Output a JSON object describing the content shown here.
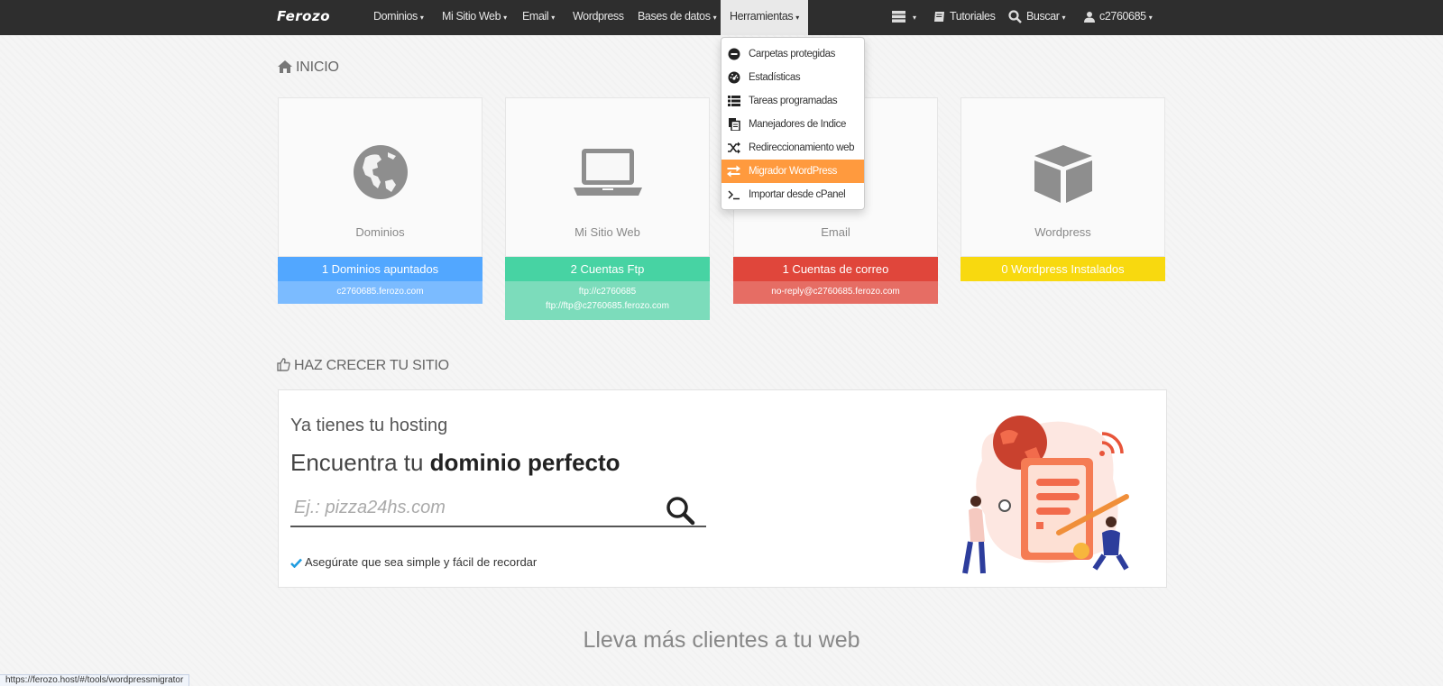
{
  "navbar": {
    "brand": "Ferozo",
    "items": [
      {
        "label": "Dominios",
        "caret": "▾"
      },
      {
        "label": "Mi Sitio Web",
        "caret": "▾"
      },
      {
        "label": "Email",
        "caret": "▾"
      },
      {
        "label": "Wordpress",
        "caret": ""
      },
      {
        "label": "Bases de datos",
        "caret": "▾"
      },
      {
        "label": "Herramientas",
        "caret": "▾"
      }
    ],
    "right": {
      "menu_caret": "▾",
      "tutorials": "Tutoriales",
      "search": "Buscar",
      "search_caret": "▾",
      "user": "c2760685",
      "user_caret": "▾"
    }
  },
  "tools_menu": [
    {
      "label": "Carpetas protegidas",
      "icon": "minus-circle-icon"
    },
    {
      "label": "Estadísticas",
      "icon": "dashboard-icon"
    },
    {
      "label": "Tareas programadas",
      "icon": "list-icon"
    },
    {
      "label": "Manejadores de Indice",
      "icon": "files-icon"
    },
    {
      "label": "Redireccionamiento web",
      "icon": "shuffle-icon"
    },
    {
      "label": "Migrador WordPress",
      "icon": "exchange-icon",
      "highlighted": true
    },
    {
      "label": "Importar desde cPanel",
      "icon": "terminal-icon"
    }
  ],
  "home": {
    "title": "INICIO",
    "cards": [
      {
        "label": "Dominios",
        "bar": "1 Dominios apuntados",
        "sub": [
          "c2760685.ferozo.com"
        ],
        "bar_color": "#52a7ff",
        "sub_color": "#7bbbff"
      },
      {
        "label": "Mi Sitio Web",
        "bar": "2 Cuentas Ftp",
        "sub": [
          "ftp://c2760685",
          "ftp://ftp@c2760685.ferozo.com"
        ],
        "bar_color": "#47d3a3",
        "sub_color": "#7cdcbb"
      },
      {
        "label": "Email",
        "bar": "1 Cuentas de correo",
        "sub": [
          "no-reply@c2760685.ferozo.com"
        ],
        "bar_color": "#e0463b",
        "sub_color": "#e66d64"
      },
      {
        "label": "Wordpress",
        "bar": "0 Wordpress Instalados",
        "sub": [],
        "bar_color": "#f8d90f",
        "sub_color": ""
      }
    ]
  },
  "grow": {
    "title": "HAZ CRECER TU SITIO",
    "line1": "Ya tienes tu hosting",
    "line2_prefix": "Encuentra tu ",
    "line2_bold": "dominio perfecto",
    "search_placeholder": "Ej.: pizza24hs.com",
    "hint": "Asegúrate que sea simple y fácil de recordar"
  },
  "bottom_title": "Lleva más clientes a tu web",
  "status_url": "https://ferozo.host/#/tools/wordpressmigrator",
  "colors": {
    "navbar": "#2e2e2e",
    "highlight": "#ff9a3e",
    "check": "#1f9ce0"
  }
}
